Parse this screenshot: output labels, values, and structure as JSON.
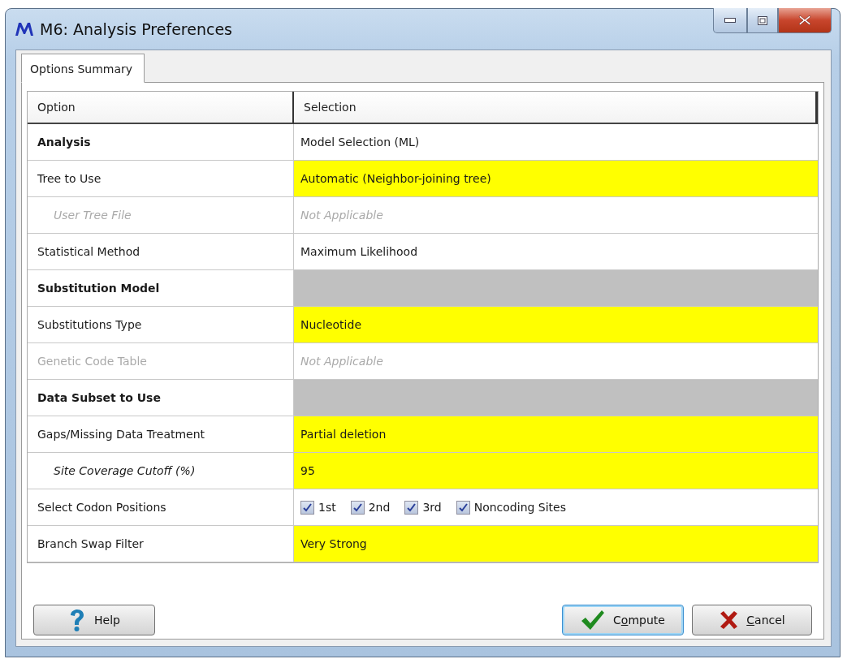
{
  "window": {
    "title": "M6: Analysis Preferences"
  },
  "tabs": [
    {
      "label": "Options Summary",
      "selected": true
    }
  ],
  "table": {
    "columns": [
      "Option",
      "Selection"
    ],
    "rows": [
      {
        "kind": "value",
        "label": "Analysis",
        "value": "Model Selection (ML)",
        "bold": true,
        "indented": false,
        "disabled": false,
        "highlighted": false
      },
      {
        "kind": "value",
        "label": "Tree to Use",
        "value": "Automatic (Neighbor-joining tree)",
        "bold": false,
        "indented": false,
        "disabled": false,
        "highlighted": true
      },
      {
        "kind": "value",
        "label": "User Tree File",
        "value": "Not Applicable",
        "bold": false,
        "indented": true,
        "disabled": true,
        "highlighted": false
      },
      {
        "kind": "value",
        "label": "Statistical Method",
        "value": "Maximum Likelihood",
        "bold": false,
        "indented": false,
        "disabled": false,
        "highlighted": false
      },
      {
        "kind": "group",
        "label": "Substitution Model",
        "bold": true,
        "indented": false,
        "disabled": false
      },
      {
        "kind": "value",
        "label": "Substitutions Type",
        "value": "Nucleotide",
        "bold": false,
        "indented": false,
        "disabled": false,
        "highlighted": true
      },
      {
        "kind": "value",
        "label": "Genetic Code Table",
        "value": "Not Applicable",
        "bold": false,
        "indented": false,
        "disabled": true,
        "highlighted": false
      },
      {
        "kind": "group",
        "label": "Data Subset to Use",
        "bold": true,
        "indented": false,
        "disabled": false
      },
      {
        "kind": "value",
        "label": "Gaps/Missing Data Treatment",
        "value": "Partial deletion",
        "bold": false,
        "indented": false,
        "disabled": false,
        "highlighted": true
      },
      {
        "kind": "value",
        "label": "Site Coverage Cutoff (%)",
        "value": "95",
        "bold": false,
        "indented": true,
        "disabled": false,
        "highlighted": true
      },
      {
        "kind": "checks",
        "label": "Select Codon Positions",
        "bold": false,
        "indented": false,
        "disabled": false,
        "options": [
          {
            "label": "1st",
            "checked": true
          },
          {
            "label": "2nd",
            "checked": true
          },
          {
            "label": "3rd",
            "checked": true
          },
          {
            "label": "Noncoding Sites",
            "checked": true
          }
        ]
      },
      {
        "kind": "value",
        "label": "Branch Swap Filter",
        "value": "Very Strong",
        "bold": false,
        "indented": false,
        "disabled": false,
        "highlighted": true
      }
    ]
  },
  "buttons": [
    {
      "kind": "help",
      "label": "Help"
    },
    {
      "kind": "compute",
      "label_before": "C",
      "mnemonic": "o",
      "label_after": "mpute"
    },
    {
      "kind": "cancel",
      "mnemonic": "C",
      "label_after": "ancel"
    }
  ]
}
